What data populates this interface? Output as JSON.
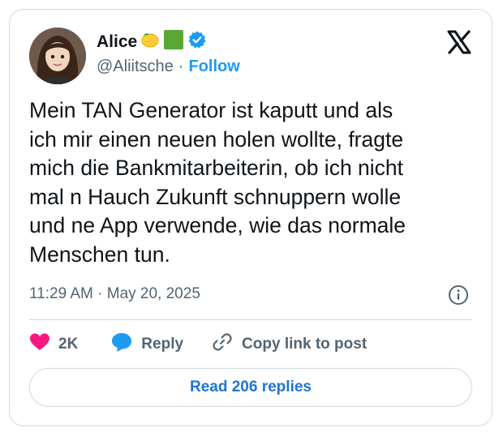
{
  "author": {
    "name": "Alice",
    "emoji_icons": [
      "lemon-icon",
      "green-square-icon"
    ],
    "verified": true,
    "handle": "@Aliitsche",
    "separator": "·",
    "follow_label": "Follow"
  },
  "tweet": {
    "lines": [
      "Mein TAN Generator ist kaputt und als",
      "ich mir einen neuen holen wollte, fragte",
      "mich die Bankmitarbeiterin, ob ich nicht",
      "mal n Hauch Zukunft schnuppern wolle",
      "und ne App verwende, wie das normale",
      "Menschen tun."
    ],
    "timestamp": "11:29 AM · May 20, 2025"
  },
  "actions": {
    "likes": "2K",
    "reply_label": "Reply",
    "copy_label": "Copy link to post"
  },
  "read_replies_label": "Read 206 replies",
  "colors": {
    "accent": "#1d9bf0",
    "heart": "#f91880",
    "verified": "#1d9bf0",
    "text": "#0f1419",
    "muted": "#536471"
  }
}
